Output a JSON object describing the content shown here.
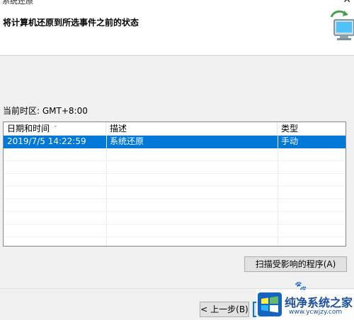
{
  "window": {
    "title": "系统还原",
    "close_glyph": "✕"
  },
  "header": {
    "heading": "将计算机还原到所选事件之前的状态"
  },
  "timezone_label": "当前时区: GMT+8:00",
  "table": {
    "columns": [
      "日期和时间",
      "描述",
      "类型"
    ],
    "rows": [
      {
        "datetime": "2019/7/5 14:22:59",
        "description": "系统还原",
        "type": "手动",
        "selected": true
      }
    ]
  },
  "buttons": {
    "scan": "扫描受影响的程序(A)",
    "back": "< 上一步(B)"
  },
  "watermark": {
    "name": "纯净系统之家",
    "url": "www.ycwjzy.com"
  },
  "colors": {
    "selection": "#0078d7",
    "header_bg": "#ffffff",
    "window_bg": "#f0f0f0"
  }
}
